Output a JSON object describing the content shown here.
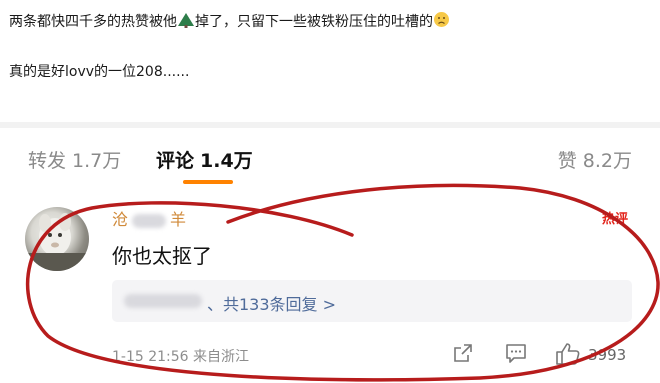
{
  "post": {
    "line1_text": "两条都快四千多的热赞被他",
    "line1_tail": "掉了，只留下一些被铁粉压住的吐槽的",
    "line2": "真的是好lovv的一位208......"
  },
  "tabs": [
    {
      "label": "转发",
      "count": "1.7万"
    },
    {
      "label": "评论",
      "count": "1.4万"
    },
    {
      "label": "赞",
      "count": "8.2万"
    }
  ],
  "comment": {
    "username_prefix": "沧",
    "username_suffix": "羊",
    "hot_badge": "热评",
    "content": "你也太抠了",
    "replies_text": "、共133条回复 >",
    "timestamp": "1-15 21:56 来自浙江",
    "like_count": "3993"
  },
  "colors": {
    "accent": "#ff8200",
    "reply_link": "#4f6b9a",
    "annotation_circle": "#b71c1c"
  },
  "icons": [
    "tree-emoji-icon",
    "sad-face-emoji-icon",
    "share-icon",
    "comment-icon",
    "thumbs-up-icon"
  ]
}
